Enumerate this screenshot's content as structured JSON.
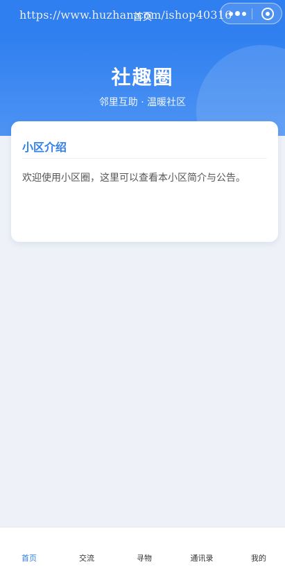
{
  "navbar": {
    "title": "首页",
    "watermark": "https://www.huzhan.com/ishop40316"
  },
  "hero": {
    "title": "社趣圈",
    "subtitle": "邻里互助 · 温暖社区"
  },
  "intro_card": {
    "title": "小区介绍",
    "text": "欢迎使用小区圈，这里可以查看本小区简介与公告。"
  },
  "tabbar": {
    "active_index": 0,
    "items": [
      {
        "label": "首页"
      },
      {
        "label": "交流"
      },
      {
        "label": "寻物"
      },
      {
        "label": "通讯录"
      },
      {
        "label": "我的"
      }
    ]
  },
  "icons": {
    "more": "more-dots-icon",
    "close": "close-miniprogram-icon"
  },
  "colors": {
    "accent": "#2f7ff0",
    "background": "#eef2f8",
    "tab_inactive": "#333333"
  }
}
